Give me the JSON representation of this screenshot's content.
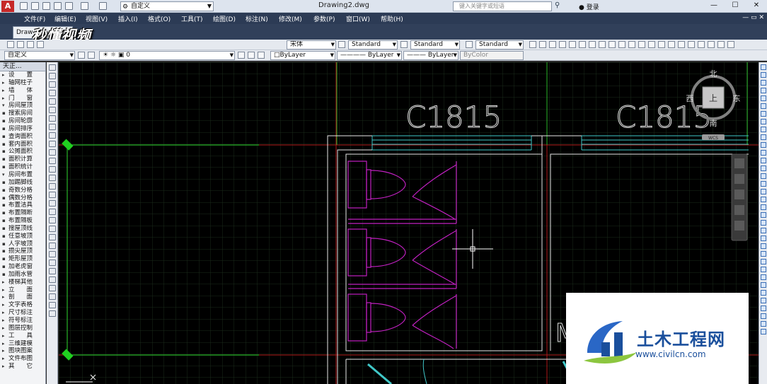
{
  "app": {
    "logo_letter": "A",
    "workspace": "自定义",
    "document_title": "Drawing2.dwg",
    "search_placeholder": "键入关键字或短语",
    "login": "登录"
  },
  "menu": [
    "文件(F)",
    "编辑(E)",
    "视图(V)",
    "插入(I)",
    "格式(O)",
    "工具(T)",
    "绘图(D)",
    "标注(N)",
    "修改(M)",
    "参数(P)",
    "窗口(W)",
    "帮助(H)"
  ],
  "tabs": {
    "doc_tab": "Draw"
  },
  "watermark": "秒懂视频",
  "toolbar1": {
    "text_font": "宋体",
    "text_style": "Standard",
    "dim_style": "Standard",
    "table_style": "Standard"
  },
  "toolbar2": {
    "named_view": "自定义",
    "layer": "0",
    "color": "ByLayer",
    "linetype": "ByLayer",
    "lineweight": "ByLayer",
    "plotstyle": "ByColor"
  },
  "left_panel": {
    "title": "天正...",
    "items": [
      "设　　置",
      "轴网柱子",
      "墙　　体",
      "门　　窗",
      "房间屋顶",
      "搜索房间",
      "房间轮廓",
      "房间排序",
      "查询面积",
      "套内面积",
      "公摊面积",
      "面积计算",
      "面积统计",
      "房间布置",
      "加踢脚线",
      "奇数分格",
      "偶数分格",
      "布置洁具",
      "布置隔断",
      "布置隔板",
      "搜屋顶线",
      "任意坡顶",
      "人字坡顶",
      "攒尖屋顶",
      "矩形屋顶",
      "加老虎窗",
      "加雨水管",
      "楼梯其他",
      "立　　面",
      "剖　　面",
      "文字表格",
      "尺寸标注",
      "符号标注",
      "图层控制",
      "工　　具",
      "三维建模",
      "图块图案",
      "文件布图",
      "其　　它"
    ]
  },
  "drawing": {
    "label_left": "C1815",
    "label_right": "C1815",
    "partial_text": "M"
  },
  "viewcube": {
    "north": "北",
    "south": "南",
    "east": "东",
    "west": "西",
    "top": "上",
    "wcs": "WCS"
  },
  "brand": {
    "name": "土木工程网",
    "url": "www.civilcn.com"
  },
  "colors": {
    "canvas": "#000000",
    "grid": "#1e2a1e",
    "wall": "#ffffff",
    "fixture": "#c020c0",
    "axis_red": "#c02020",
    "window_cyan": "#40c0c0",
    "green": "#30c030"
  }
}
